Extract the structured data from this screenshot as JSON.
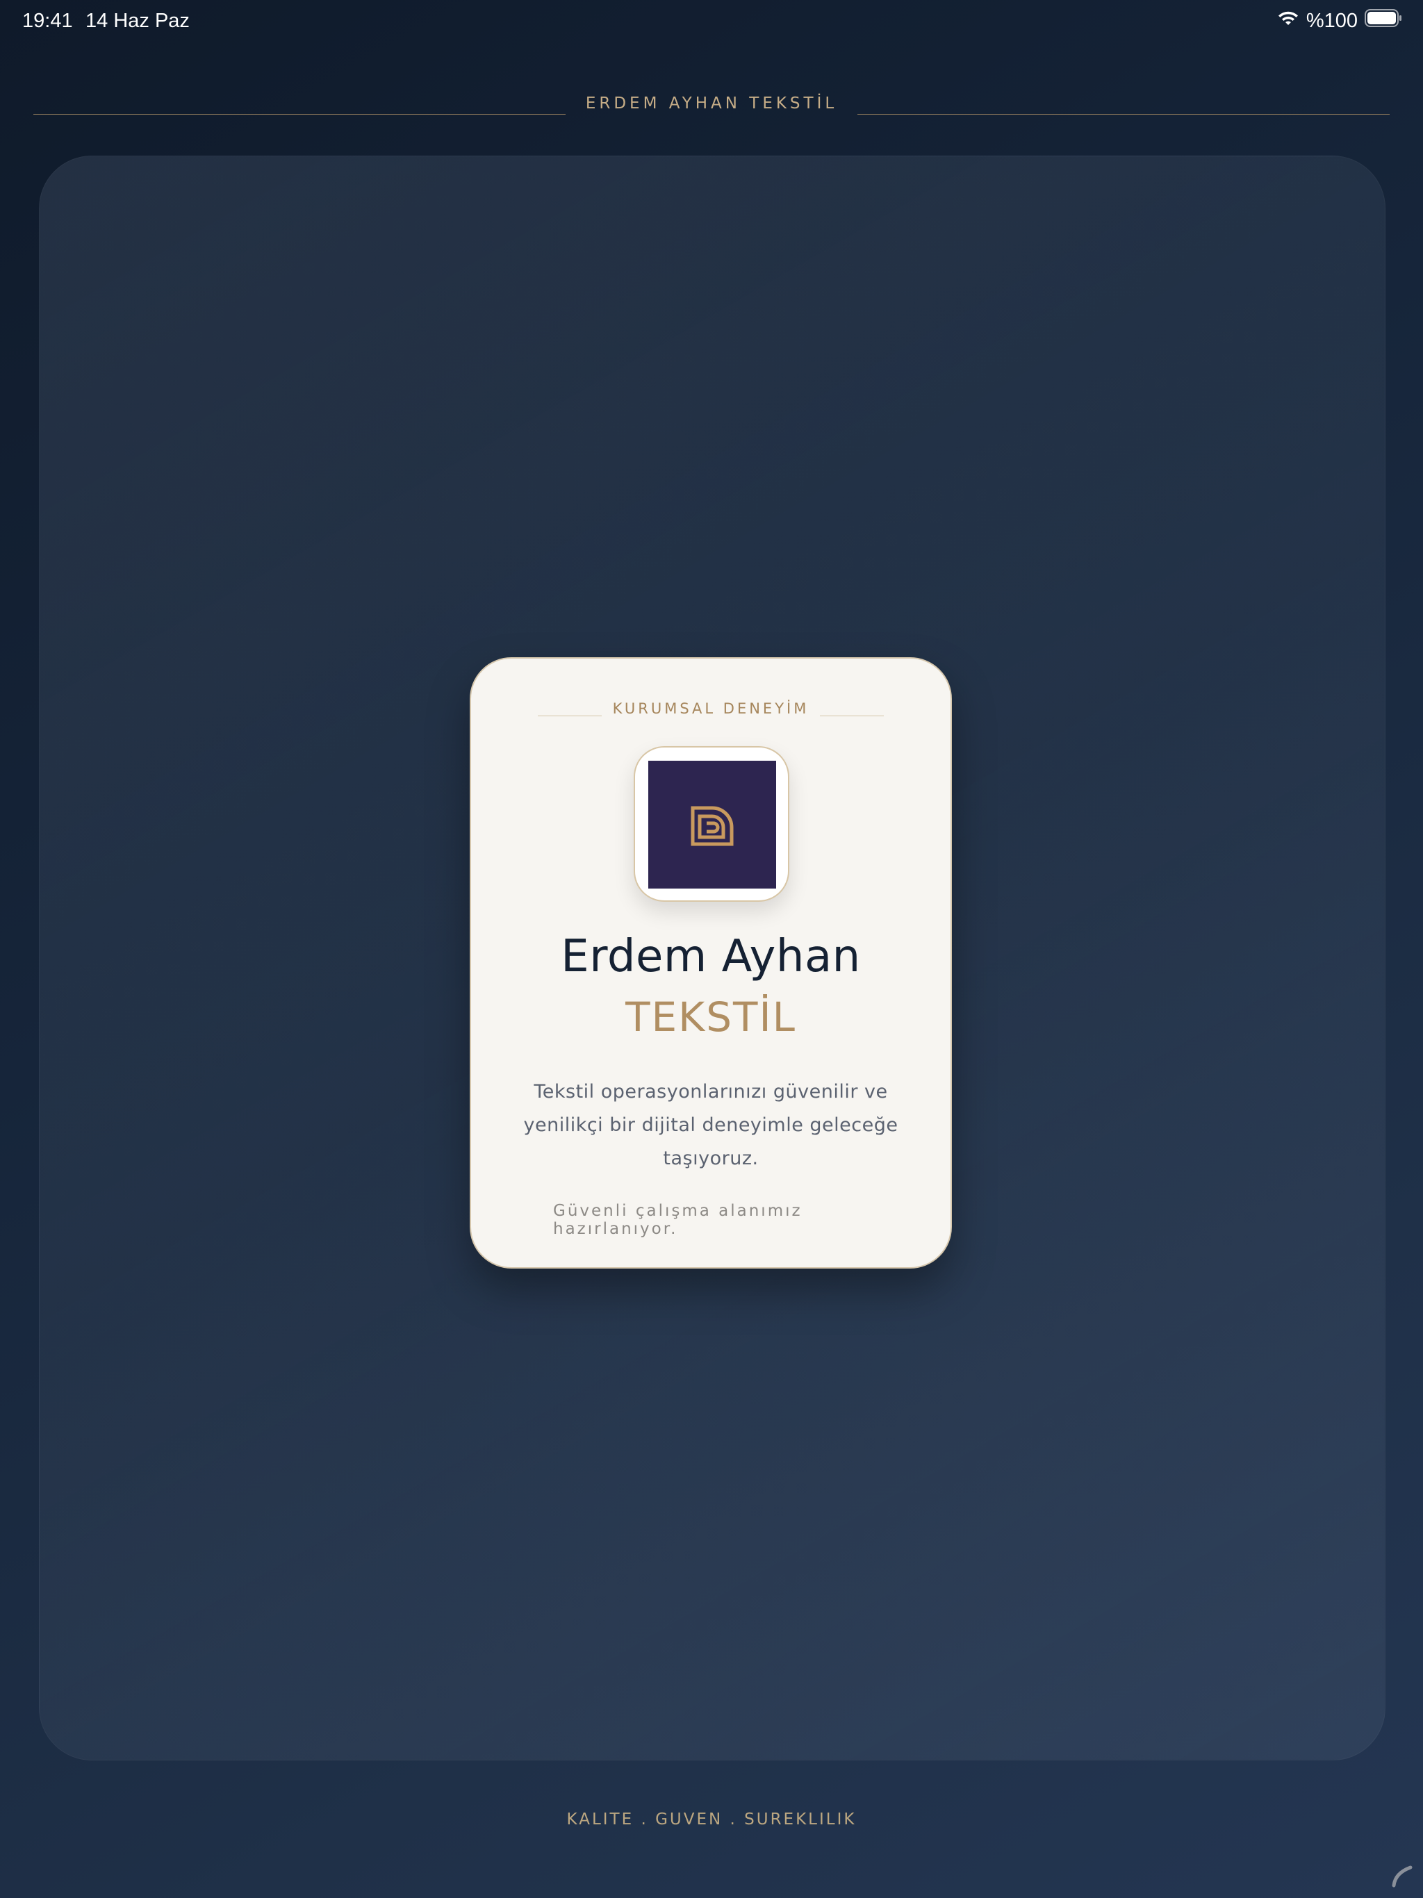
{
  "status_bar": {
    "time": "19:41",
    "date": "14 Haz Paz",
    "battery": "%100",
    "icons": [
      "wifi-icon",
      "battery-icon"
    ]
  },
  "header": {
    "brand": "ERDEM AYHAN TEKSTİL"
  },
  "card": {
    "eyebrow": "KURUMSAL DENEYİM",
    "logo_icon": "brand-monogram-icon",
    "title": "Erdem Ayhan",
    "subtitle": "TEKSTİL",
    "description": "Tekstil operasyonlarınızı güvenilir ve yenilikçi bir dijital deneyimle geleceğe taşıyoruz.",
    "status_note": "Güvenli çalışma alanımız hazırlanıyor."
  },
  "footer": {
    "tagline": "KALITE . GUVEN . SUREKLILIK"
  },
  "colors": {
    "background": "#16253a",
    "card": "#f7f5f1",
    "accent_gold": "#b08e62",
    "logo_bg": "#2d2550",
    "title_dark": "#152133"
  }
}
